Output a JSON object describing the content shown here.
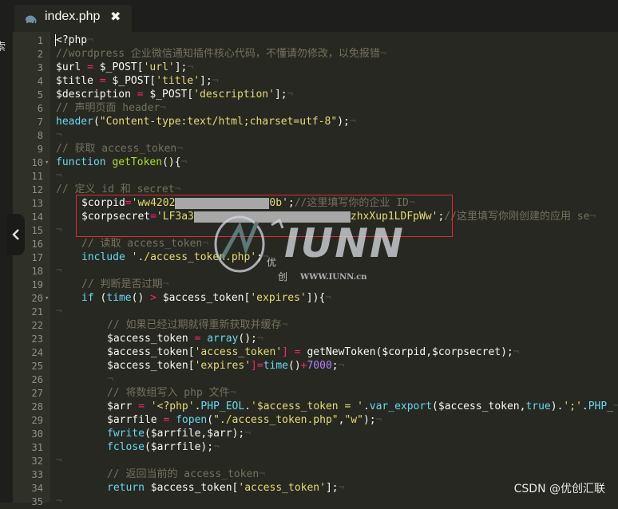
{
  "tab": {
    "title": "index.php",
    "close_icon": "✖",
    "icon": "elephant-icon"
  },
  "sidebar": {
    "label": "索"
  },
  "gutter": {
    "line_numbers": [
      "1",
      "2",
      "3",
      "4",
      "5",
      "6",
      "7",
      "8",
      "9",
      "10",
      "11",
      "12",
      "13",
      "14",
      "15",
      "16",
      "17",
      "18",
      "19",
      "20",
      "21",
      "22",
      "23",
      "24",
      "25",
      "26",
      "27",
      "28",
      "29",
      "30",
      "31",
      "32",
      "33",
      "34",
      "35"
    ]
  },
  "code": {
    "l1": "<?php",
    "l2": "//wordpress 企业微信通知插件核心代码，不懂请勿修改，以免报错",
    "l3a": "$url",
    "l3b": " = ",
    "l3c": "$_POST",
    "l3d": "[",
    "l3e": "'url'",
    "l3f": "];",
    "l4a": "$title",
    "l4b": " = ",
    "l4c": "$_POST",
    "l4d": "[",
    "l4e": "'title'",
    "l4f": "];",
    "l5a": "$description",
    "l5b": " = ",
    "l5c": "$_POST",
    "l5d": "[",
    "l5e": "'description'",
    "l5f": "];",
    "l6": "// 声明页面 header",
    "l7a": "header",
    "l7b": "(",
    "l7c": "\"Content-type:text/html;charset=utf-8\"",
    "l7d": ");",
    "l9": "// 获取 access_token",
    "l10a": "function",
    "l10b": " getToken",
    "l10c": "(){",
    "l12": "// 定义 id 和 secret",
    "l13a": "$corpid",
    "l13b": "=",
    "l13c": "'ww4202",
    "l13d": "0b'",
    "l13e": ";",
    "l13f": "//这里填写你的企业 ID",
    "l14a": "$corpsecret",
    "l14b": "=",
    "l14c": "'LF3a3",
    "l14d": "zhxXup1LDFpWw'",
    "l14e": ";",
    "l14f": "//这里填写你刚创建的应用 se",
    "l16": "// 读取 access_token",
    "l17a": "include",
    "l17b": " './access_token.php'",
    "l17c": ";",
    "l19": "// 判断是否过期",
    "l20a": "if",
    "l20b": " (",
    "l20c": "time",
    "l20d": "() ",
    "l20e": ">",
    "l20f": " $access_token",
    "l20g": "[",
    "l20h": "'expires'",
    "l20i": "]){",
    "l22": "// 如果已经过期就得重新获取并缓存",
    "l23a": "$access_token",
    "l23b": " = ",
    "l23c": "array",
    "l23d": "();",
    "l24a": "$access_token",
    "l24b": "[",
    "l24c": "'access_token'",
    "l24d": "] = ",
    "l24e": "getNewToken",
    "l24f": "(",
    "l24g": "$corpid",
    "l24h": ",",
    "l24i": "$corpsecret",
    "l24j": ");",
    "l25a": "$access_token",
    "l25b": "[",
    "l25c": "'expires'",
    "l25d": "]=",
    "l25e": "time",
    "l25f": "()",
    "l25g": "+",
    "l25h": "7000",
    "l25i": ";",
    "l27": "// 将数组写入 php 文件",
    "l28a": "$arr",
    "l28b": " = ",
    "l28c": "'<?php'",
    "l28d": ".",
    "l28e": "PHP_EOL",
    "l28f": ".",
    "l28g": "'$access_token = '",
    "l28h": ".",
    "l28i": "var_export",
    "l28j": "(",
    "l28k": "$access_token",
    "l28l": ",",
    "l28m": "true",
    "l28n": ").",
    "l28o": "';'",
    "l28p": ".",
    "l28q": "PHP_",
    "l29a": "$arrfile",
    "l29b": " = ",
    "l29c": "fopen",
    "l29d": "(",
    "l29e": "\"./access_token.php\"",
    "l29f": ",",
    "l29g": "\"w\"",
    "l29h": ");",
    "l30a": "fwrite",
    "l30b": "(",
    "l30c": "$arrfile",
    "l30d": ",",
    "l30e": "$arr",
    "l30f": ");",
    "l31a": "fclose",
    "l31b": "(",
    "l31c": "$arrfile",
    "l31d": ");",
    "l33": "// 返回当前的 access_token",
    "l34a": "return",
    "l34b": " $access_token",
    "l34c": "[",
    "l34d": "'access_token'",
    "l34e": "];"
  },
  "watermark": {
    "text_big": "IUNN",
    "text_url": "WWW.IUNN.cn",
    "char1": "优",
    "char2": "创"
  },
  "footer": {
    "csdn": "CSDN @优创汇联"
  },
  "colors": {
    "background": "#272822",
    "keyword": "#66d9ef",
    "string": "#e6db74",
    "comment": "#75715e",
    "operator": "#f92672",
    "number": "#ae81ff",
    "highlight_box": "#d7302b"
  }
}
